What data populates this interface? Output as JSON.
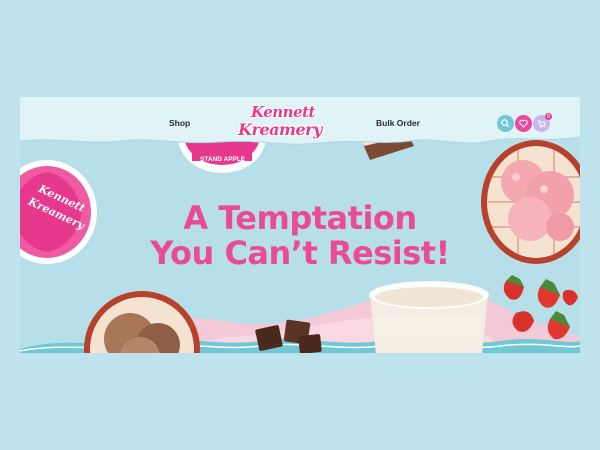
{
  "header": {
    "nav_left": "Shop",
    "nav_right": "Bulk Order",
    "logo_line1": "Kennett",
    "logo_line2": "Kreamery",
    "cart_count": "0",
    "icons": [
      "search-icon",
      "heart-icon",
      "cart-icon"
    ]
  },
  "hero": {
    "title_line1": "A Temptation",
    "title_line2": "You Can’t Resist!",
    "tub_lid_text": "STAND APPLE"
  },
  "colors": {
    "accent_pink": "#e94b9a",
    "brand_pink": "#e63a8c",
    "teal": "#6fc8d3",
    "background": "#bfe3ec"
  }
}
